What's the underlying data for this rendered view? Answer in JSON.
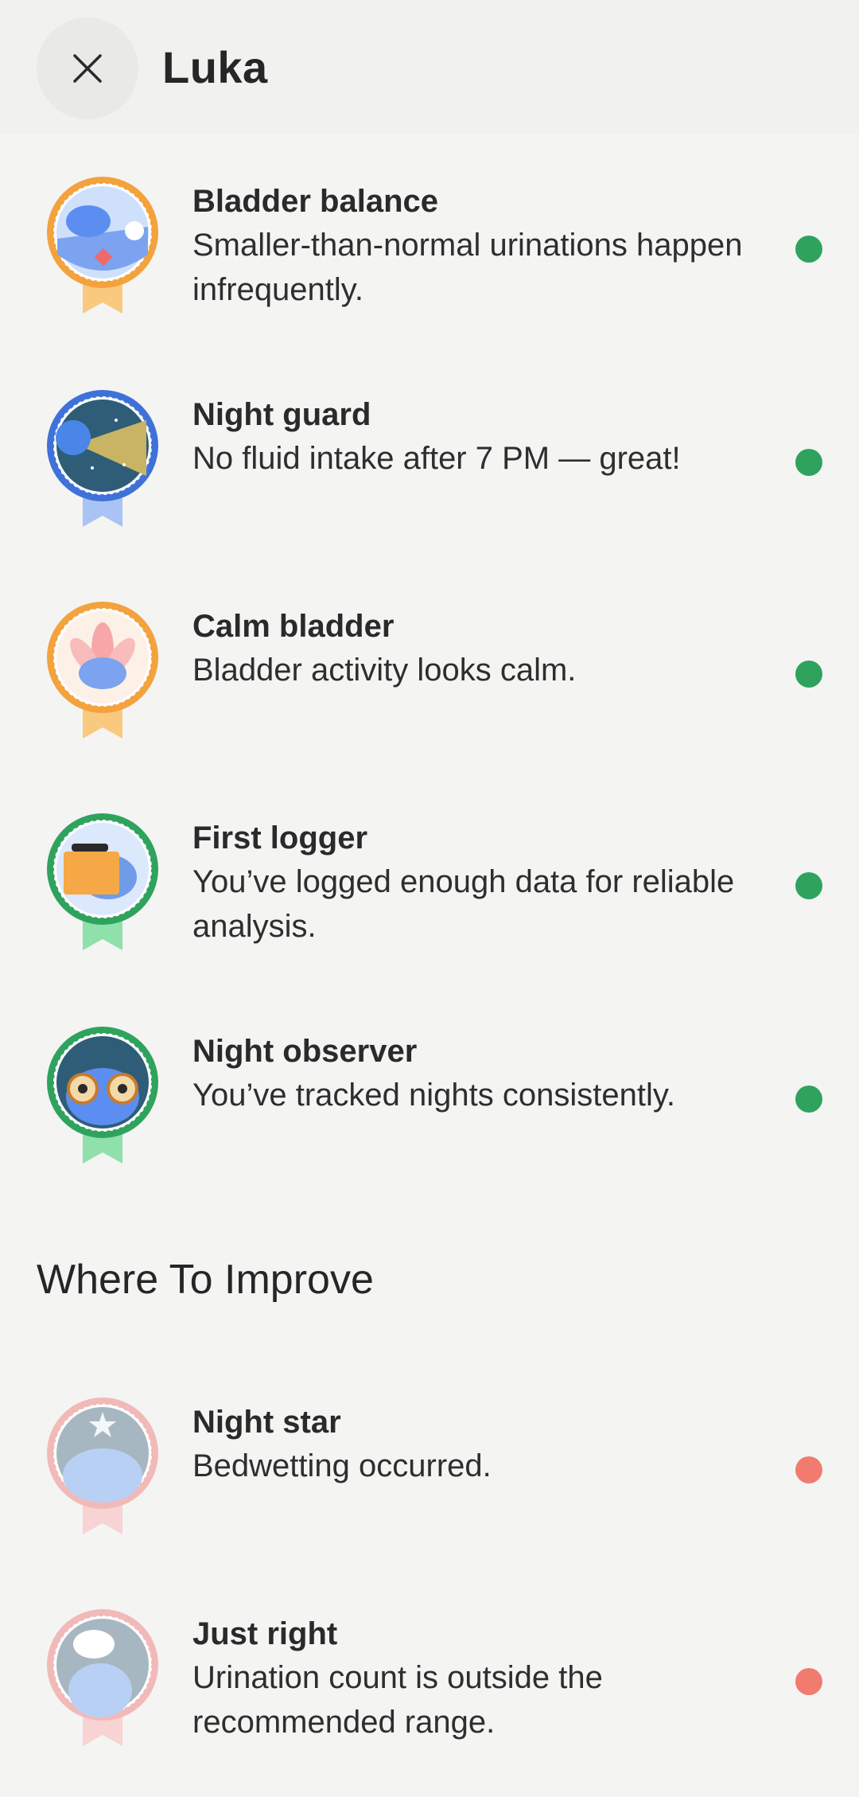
{
  "header": {
    "title": "Luka",
    "close_icon": "close-icon"
  },
  "achievements": [
    {
      "title": "Bladder balance",
      "desc": "Smaller-than-normal urinations happen infrequently.",
      "status": "good",
      "badge_color": "#f3a23d",
      "ribbon_color": "#f9c97f",
      "icon": "bladder-balance-badge-icon"
    },
    {
      "title": "Night guard",
      "desc": "No fluid intake after 7 PM — great!",
      "status": "good",
      "badge_color": "#3f72d9",
      "ribbon_color": "#a9c3f4",
      "icon": "night-guard-badge-icon"
    },
    {
      "title": "Calm bladder",
      "desc": "Bladder activity looks calm.",
      "status": "good",
      "badge_color": "#f3a23d",
      "ribbon_color": "#f9c97f",
      "icon": "calm-bladder-badge-icon"
    },
    {
      "title": "First logger",
      "desc": "You’ve logged enough data for reliable analysis.",
      "status": "good",
      "badge_color": "#2fa35d",
      "ribbon_color": "#8fe0ab",
      "icon": "first-logger-badge-icon"
    },
    {
      "title": "Night observer",
      "desc": "You’ve tracked nights consistently.",
      "status": "good",
      "badge_color": "#2fa35d",
      "ribbon_color": "#8fe0ab",
      "icon": "night-observer-badge-icon"
    }
  ],
  "improve": {
    "section_title": "Where To Improve",
    "items": [
      {
        "title": "Night star",
        "desc": "Bedwetting occurred.",
        "status": "bad",
        "badge_color": "#f2b9b9",
        "ribbon_color": "#f7d3d3",
        "icon": "night-star-badge-icon"
      },
      {
        "title": "Just right",
        "desc": "Urination count is outside the recommended range.",
        "status": "bad",
        "badge_color": "#f2b9b9",
        "ribbon_color": "#f7d3d3",
        "icon": "just-right-badge-icon"
      }
    ]
  },
  "colors": {
    "good": "#2fa35d",
    "bad": "#f07b6e",
    "background": "#f4f4f3"
  }
}
